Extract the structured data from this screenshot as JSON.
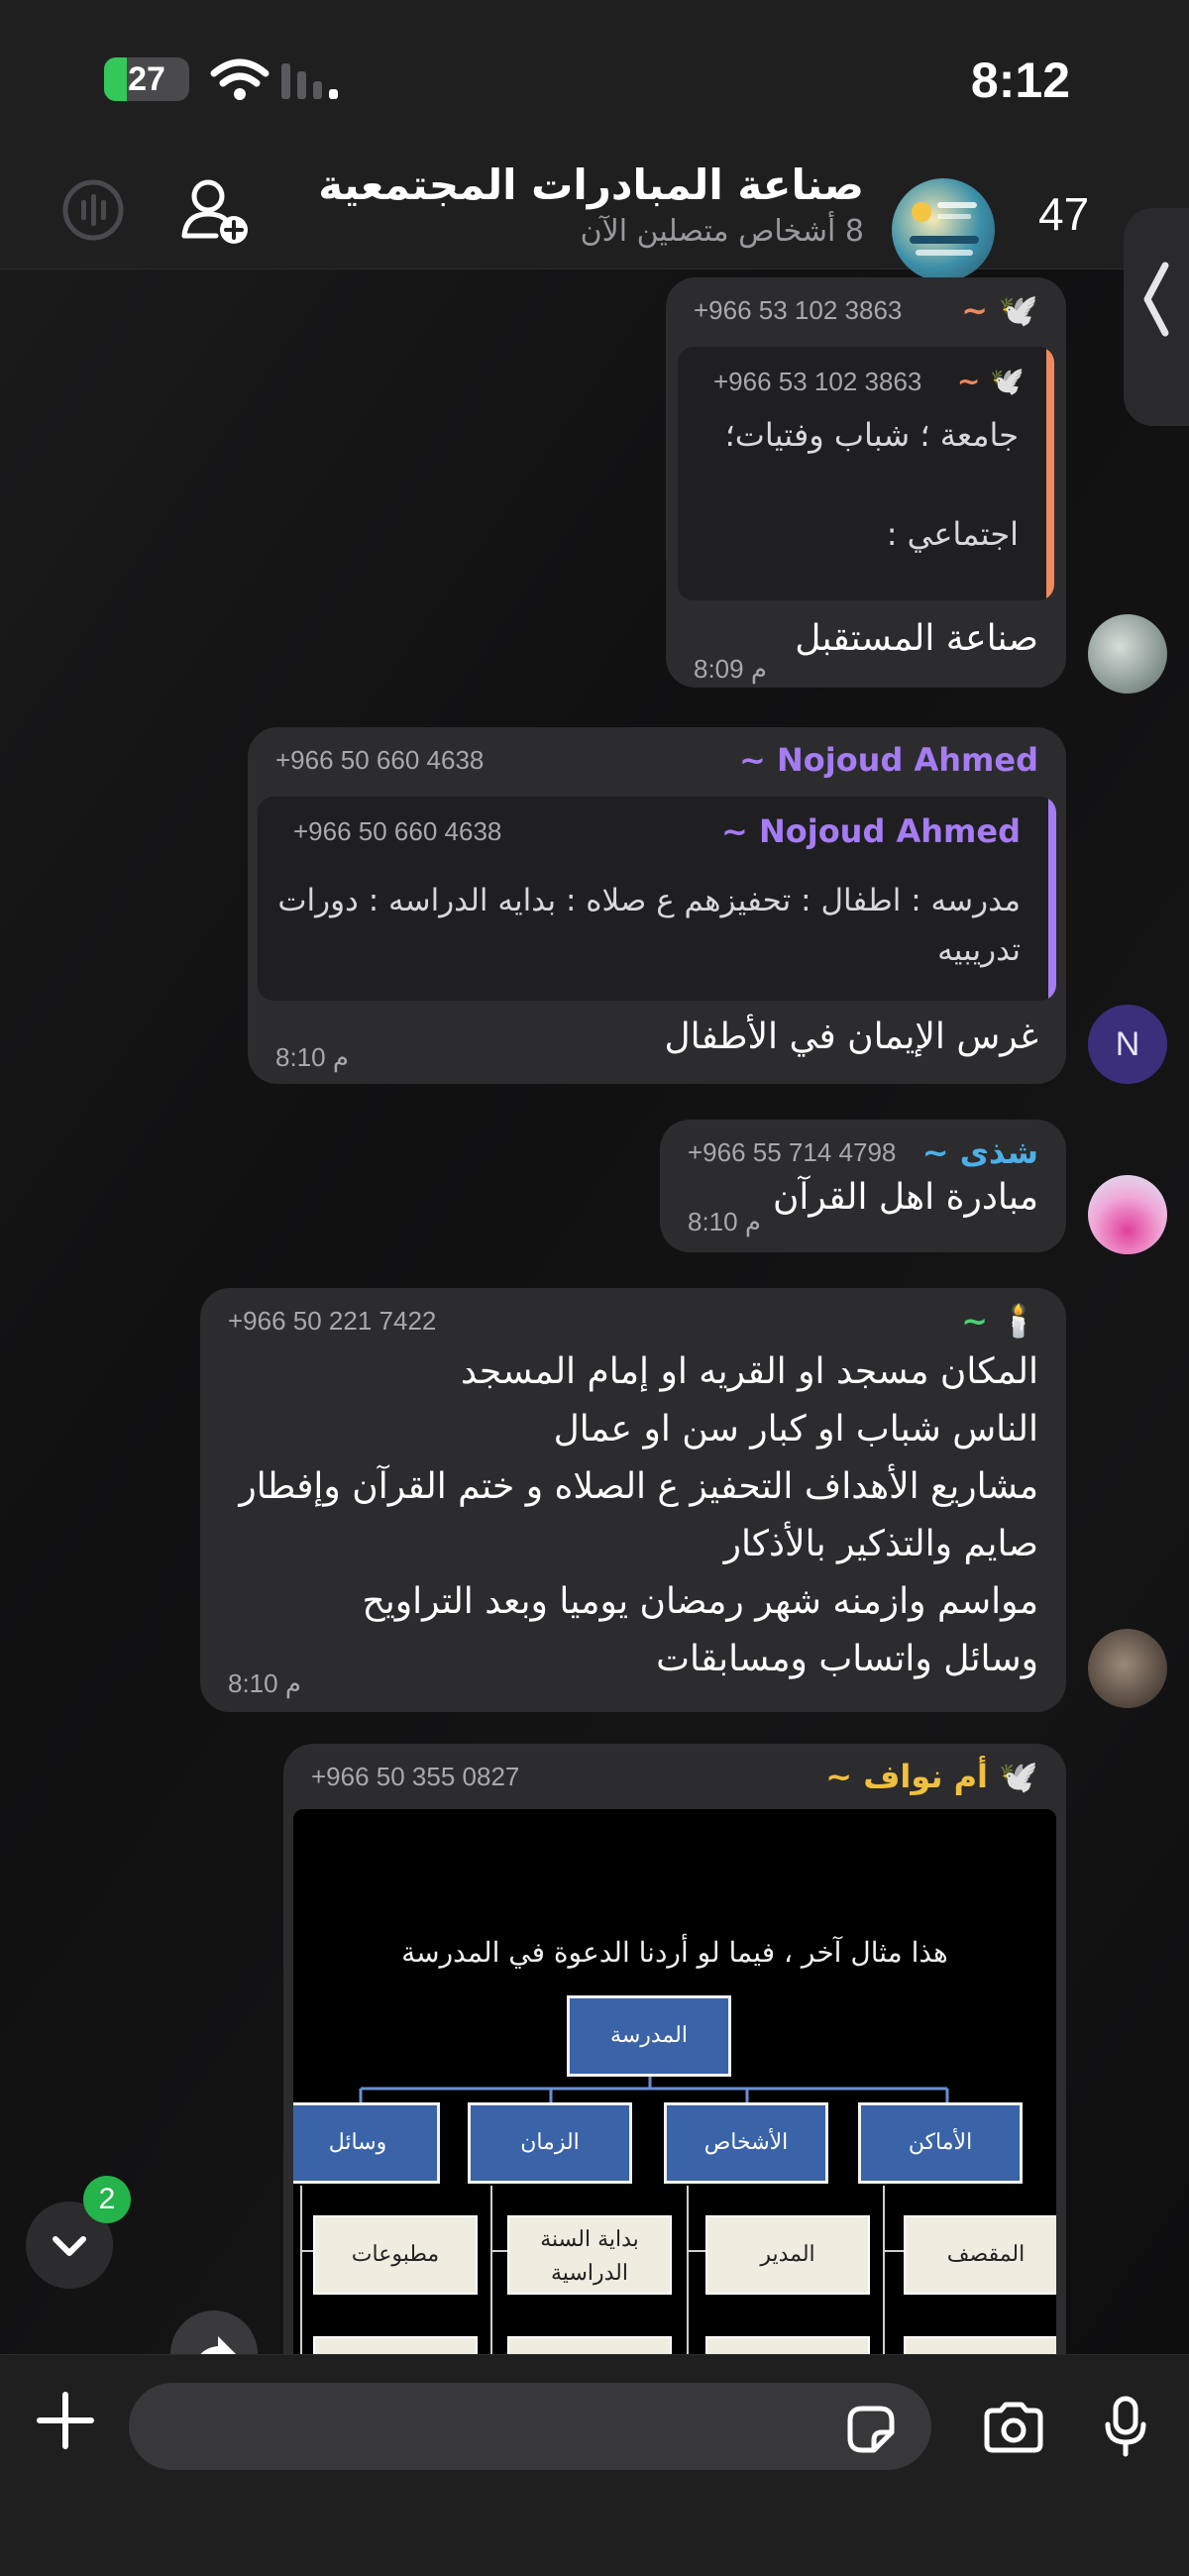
{
  "status_bar": {
    "battery": "27",
    "battery_level": 0.27,
    "time": "8:12"
  },
  "header": {
    "back_count": "47",
    "title": "صناعة المبادرات المجتمعية",
    "subtitle": "8 أشخاص متصلين الآن"
  },
  "messages": [
    {
      "sender": "~ 🕊️",
      "phone": "+966 53 102 3863",
      "name_color": "#f08a5d",
      "quote": {
        "sender": "~ 🕊️",
        "phone": "+966 53 102 3863",
        "lines": [
          "جامعة ؛ شباب وفتيات؛",
          "",
          "اجتماعي :"
        ],
        "bar_color": "#f08a5d"
      },
      "text": "صناعة المستقبل",
      "time": "8:09 م"
    },
    {
      "sender": "~ Nojoud Ahmed",
      "phone": "+966 50 660 4638",
      "name_color": "#a57cf2",
      "quote": {
        "sender": "~ Nojoud Ahmed",
        "phone": "+966 50 660 4638",
        "lines": [
          "مدرسه : اطفال : تحفيزهم ع صلاه : بدايه الدراسه : دورات",
          "تدريبيه"
        ],
        "bar_color": "#a57cf2"
      },
      "text": "غرس الإيمان في الأطفال",
      "time": "8:10 م",
      "avatar_letter": "N"
    },
    {
      "sender": "~ شذى",
      "phone": "+966 55 714 4798",
      "name_color": "#4cb0e8",
      "text": "مبادرة اهل القرآن",
      "time": "8:10 م"
    },
    {
      "sender": "~ 🕯️",
      "phone": "+966 50 221 7422",
      "name_color": "#4cd07a",
      "lines": [
        "المكان مسجد او القريه او إمام المسجد",
        "الناس شباب او كبار سن او عمال",
        "مشاريع الأهداف التحفيز ع الصلاه و ختم القرآن وإفطار",
        "صايم والتذكير بالأذكار",
        "مواسم وازمنه شهر رمضان يوميا وبعد التراويح",
        "وسائل واتساب ومسابقات"
      ],
      "time": "8:10 م"
    },
    {
      "sender": "~ أم نواف 🕊️",
      "phone": "+966 50 355 0827",
      "name_color": "#f0c040",
      "image": {
        "title": "هذا مثال آخر ، فيما لو أردنا الدعوة في المدرسة",
        "root": "المدرسة",
        "branches": [
          "الأماكن",
          "الأشخاص",
          "الزمان",
          "وسائل"
        ],
        "leaves": [
          "المقصف",
          "المدير",
          "بداية السنة الدراسية",
          "مطبوعات"
        ]
      }
    }
  ],
  "scroll": {
    "unread": "2"
  },
  "input": {
    "placeholder": ""
  }
}
